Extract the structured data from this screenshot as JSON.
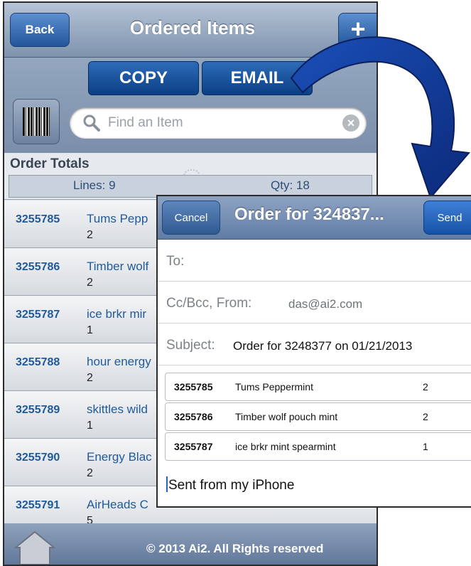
{
  "orders_screen": {
    "back_label": "Back",
    "title": "Ordered Items",
    "add_label": "+",
    "copy_label": "COPY",
    "email_label": "EMAIL",
    "search_placeholder": "Find an Item",
    "totals_title": "Order Totals",
    "lines_text": "Lines: 9",
    "qty_text": "Qty: 18",
    "items": [
      {
        "code": "3255785",
        "name": "Tums Pepp",
        "qty": "2"
      },
      {
        "code": "3255786",
        "name": "Timber wolf",
        "qty": "2"
      },
      {
        "code": "3255787",
        "name": "ice brkr mir",
        "qty": "1"
      },
      {
        "code": "3255788",
        "name": "hour energy",
        "qty": "2"
      },
      {
        "code": "3255789",
        "name": "skittles wild",
        "qty": "1"
      },
      {
        "code": "3255790",
        "name": "Energy Blac",
        "qty": "2"
      },
      {
        "code": "3255791",
        "name": "AirHeads C",
        "qty": "5"
      }
    ],
    "footer_text": "© 2013 Ai2. All Rights reserved"
  },
  "email_screen": {
    "cancel_label": "Cancel",
    "title": "Order for 324837...",
    "send_label": "Send",
    "to_label": "To:",
    "cc_label": "Cc/Bcc, From:",
    "from_value": "das@ai2.com",
    "subject_label": "Subject:",
    "subject_value": "Order for 3248377 on 01/21/2013",
    "lines": [
      {
        "code": "3255785",
        "name": "Tums Peppermint",
        "qty": "2"
      },
      {
        "code": "3255786",
        "name": "Timber wolf pouch mint",
        "qty": "2"
      },
      {
        "code": "3255787",
        "name": "ice brkr mint spearmint",
        "qty": "1"
      }
    ],
    "signature": "Sent from my iPhone"
  },
  "colors": {
    "nav_blue": "#7e93ae",
    "button_blue": "#0b3f84",
    "link_blue": "#1f5a9a",
    "arrow_blue": "#123a99"
  }
}
